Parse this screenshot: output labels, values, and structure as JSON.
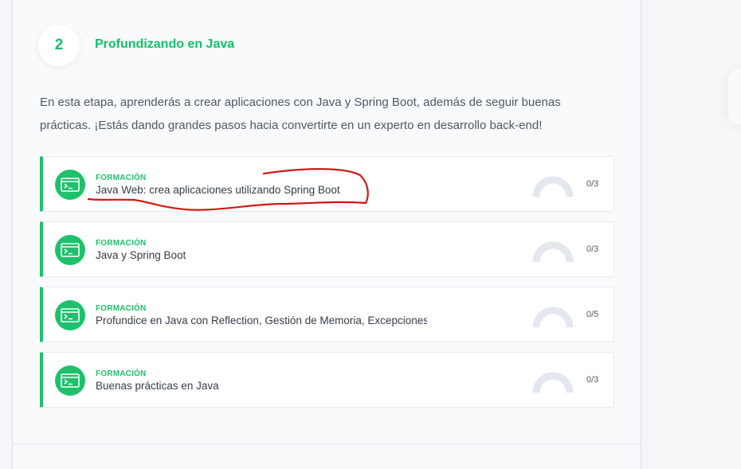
{
  "step": {
    "number": "2",
    "title": "Profundizando en Java",
    "description": "En esta etapa, aprenderás a crear aplicaciones con Java y Spring Boot, además de seguir buenas prácticas. ¡Estás dando grandes pasos hacia convertirte en un experto en desarrollo back-end!"
  },
  "courses": [
    {
      "kind": "FORMACIÓN",
      "title": "Java Web: crea aplicaciones utilizando Spring Boot",
      "count": "0/3",
      "progress": 0
    },
    {
      "kind": "FORMACIÓN",
      "title": "Java y Spring Boot",
      "count": "0/3",
      "progress": 0
    },
    {
      "kind": "FORMACIÓN",
      "title": "Profundice en Java con Reflection, Gestión de Memoria, Excepciones, Threads",
      "count": "0/5",
      "progress": 0
    },
    {
      "kind": "FORMACIÓN",
      "title": "Buenas prácticas en Java",
      "count": "0/3",
      "progress": 0
    }
  ],
  "icons": {
    "course": "terminal-window-icon"
  },
  "colors": {
    "accent": "#1ec16b",
    "progress_track": "#e3e7ee",
    "annotation": "#d41616"
  }
}
